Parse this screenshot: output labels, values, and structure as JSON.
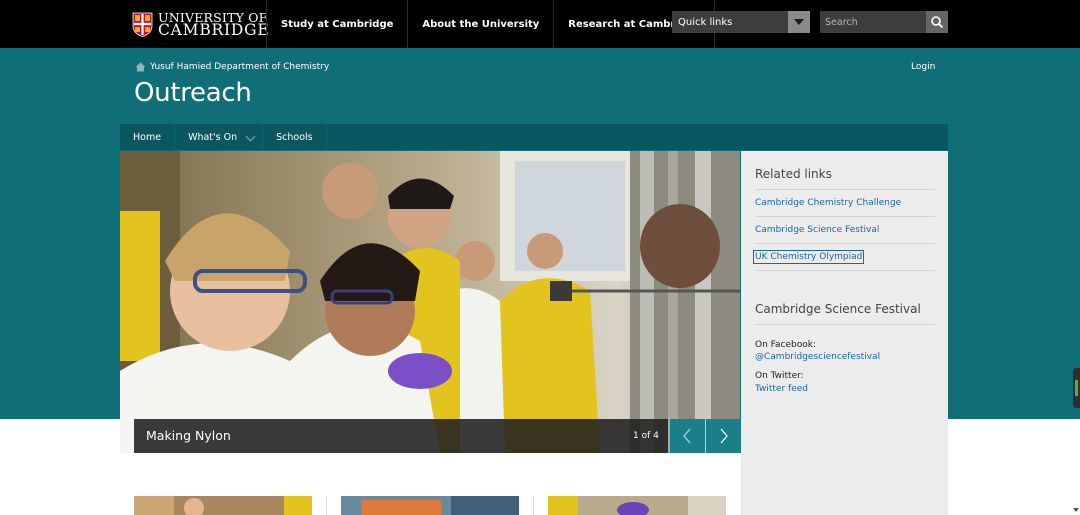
{
  "header": {
    "logo": {
      "line1": "UNIVERSITY OF",
      "line2": "CAMBRIDGE"
    },
    "nav": [
      {
        "label": "Study at Cambridge"
      },
      {
        "label": "About the University"
      },
      {
        "label": "Research at Cambridge"
      }
    ],
    "quick_links": {
      "label": "Quick links"
    },
    "search": {
      "placeholder": "Search"
    }
  },
  "breadcrumb": {
    "label": "Yusuf Hamied Department of Chemistry"
  },
  "login_label": "Login",
  "page_title": "Outreach",
  "subnav": [
    {
      "label": "Home"
    },
    {
      "label": "What's On"
    },
    {
      "label": "Schools"
    }
  ],
  "carousel": {
    "caption": "Making Nylon",
    "counter": "1 of 4"
  },
  "sidebar": {
    "related": {
      "heading": "Related links",
      "links": [
        {
          "label": "Cambridge Chemistry Challenge"
        },
        {
          "label": "Cambridge Science Festival"
        },
        {
          "label": "UK Chemistry Olympiad"
        }
      ]
    },
    "festival": {
      "heading": "Cambridge Science Festival",
      "facebook_label": "On Facebook:",
      "facebook_link": "@Cambridgesciencefestival",
      "twitter_label": "On Twitter:",
      "twitter_link": "Twitter feed"
    }
  },
  "colors": {
    "topbar": "#000000",
    "teal": "#106e79",
    "subnav": "#0b5760",
    "link": "#1d64a8",
    "sidebar_bg": "#ececec"
  }
}
